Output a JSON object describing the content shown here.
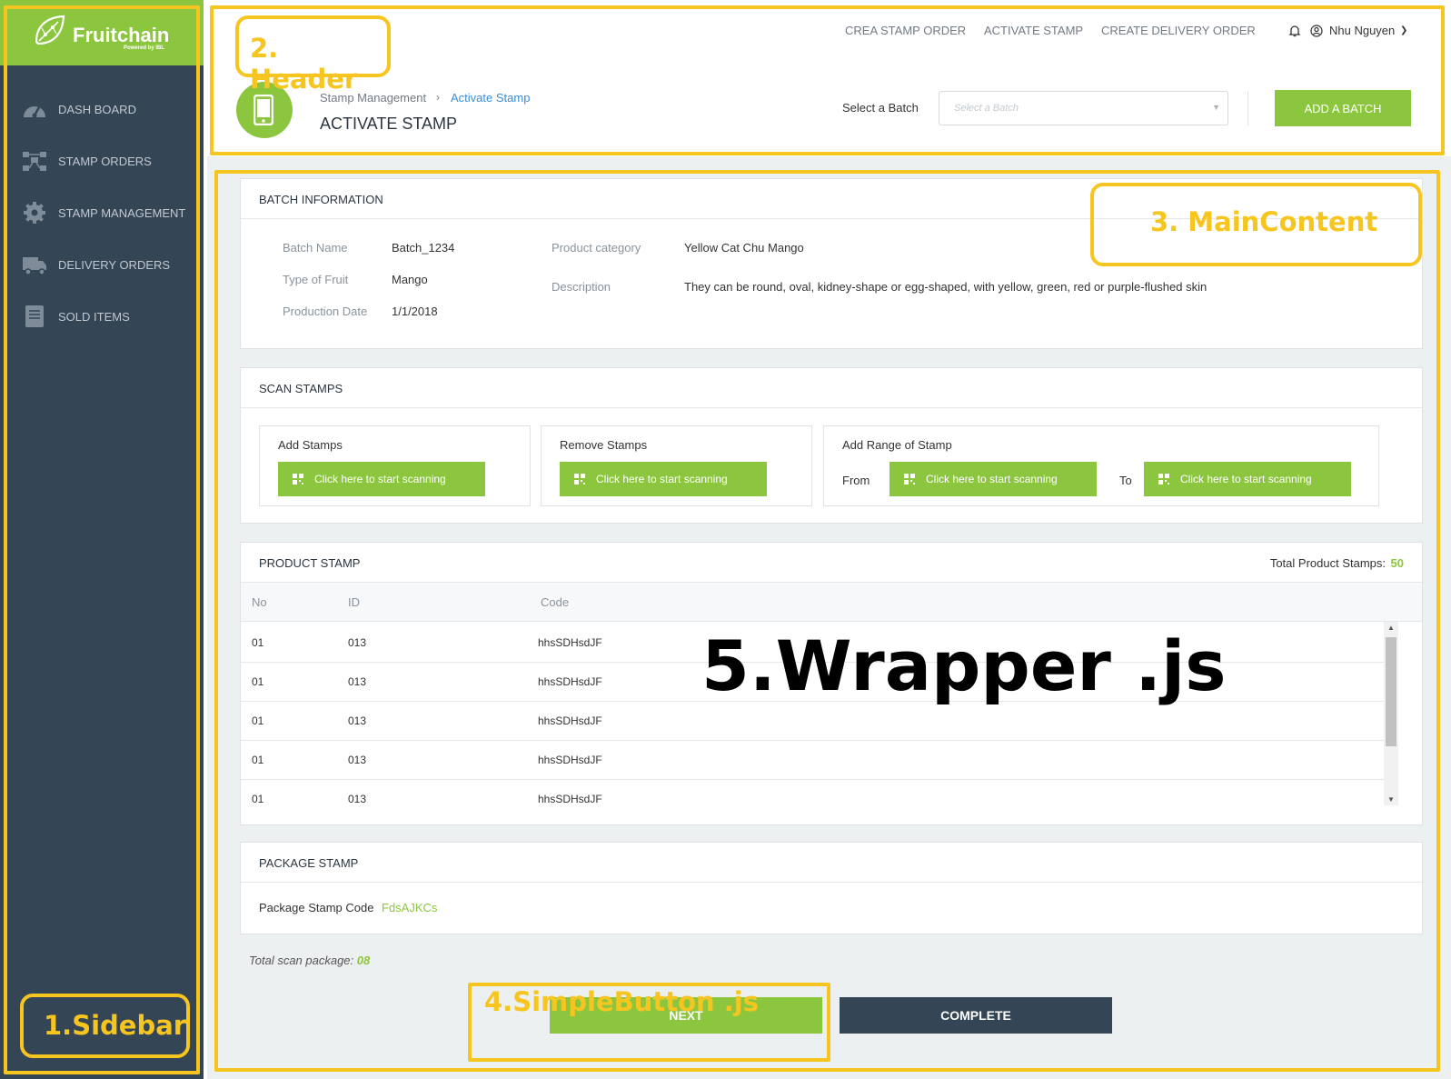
{
  "sidebar": {
    "logo": {
      "brand": "Fruitchain",
      "powered": "Powered by IBL"
    },
    "items": [
      {
        "label": "DASH BOARD",
        "icon": "dashboard-icon"
      },
      {
        "label": "STAMP ORDERS",
        "icon": "orders-icon"
      },
      {
        "label": "STAMP MANAGEMENT",
        "icon": "gear-icon"
      },
      {
        "label": "DELIVERY ORDERS",
        "icon": "truck-icon"
      },
      {
        "label": "SOLD ITEMS",
        "icon": "book-icon"
      }
    ]
  },
  "header": {
    "nav": [
      "CREA STAMP ORDER",
      "ACTIVATE STAMP",
      "CREATE DELIVERY ORDER"
    ],
    "user": "Nhu Nguyen",
    "breadcrumb": [
      "Stamp Management",
      "Activate Stamp"
    ],
    "page_title": "ACTIVATE STAMP",
    "select_label": "Select a Batch",
    "select_placeholder": "Select a Batch",
    "add_button": "ADD A BATCH"
  },
  "batch_info": {
    "title": "BATCH INFORMATION",
    "fields": [
      {
        "label": "Batch Name",
        "value": "Batch_1234"
      },
      {
        "label": "Type of Fruit",
        "value": "Mango"
      },
      {
        "label": "Production Date",
        "value": "1/1/2018"
      },
      {
        "label": "Product category",
        "value": "Yellow Cat Chu Mango"
      },
      {
        "label": "Description",
        "value": "They can be round, oval, kidney-shape or egg-shaped, with yellow, green, red or purple-flushed skin"
      }
    ]
  },
  "scan_stamps": {
    "title": "SCAN STAMPS",
    "add_title": "Add Stamps",
    "remove_title": "Remove Stamps",
    "range_title": "Add Range of Stamp",
    "from_label": "From",
    "to_label": "To",
    "scan_button": "Click here to start scanning"
  },
  "product_stamp": {
    "title": "PRODUCT STAMP",
    "total_label": "Total Product Stamps:",
    "total_value": "50",
    "columns": [
      "No",
      "ID",
      "Code"
    ],
    "rows": [
      [
        "01",
        "013",
        "hhsSDHsdJF"
      ],
      [
        "01",
        "013",
        "hhsSDHsdJF"
      ],
      [
        "01",
        "013",
        "hhsSDHsdJF"
      ],
      [
        "01",
        "013",
        "hhsSDHsdJF"
      ],
      [
        "01",
        "013",
        "hhsSDHsdJF"
      ]
    ]
  },
  "package_stamp": {
    "title": "PACKAGE STAMP",
    "code_label": "Package Stamp Code",
    "code_value": "FdsAJKCs"
  },
  "footer": {
    "total_scan_label": "Total scan package:",
    "total_scan_value": "08",
    "next_button": "NEXT",
    "complete_button": "COMPLETE"
  },
  "annotations": {
    "sidebar": "1.Sidebar",
    "header": "2. Header",
    "main": "3. MainContent",
    "button": "4.SimpleButton .js",
    "wrapper": "5.Wrapper .js"
  },
  "colors": {
    "accent": "#8cc63f",
    "sidebar": "#344556",
    "link": "#3a8dd8",
    "annotation": "#f7c51f"
  }
}
